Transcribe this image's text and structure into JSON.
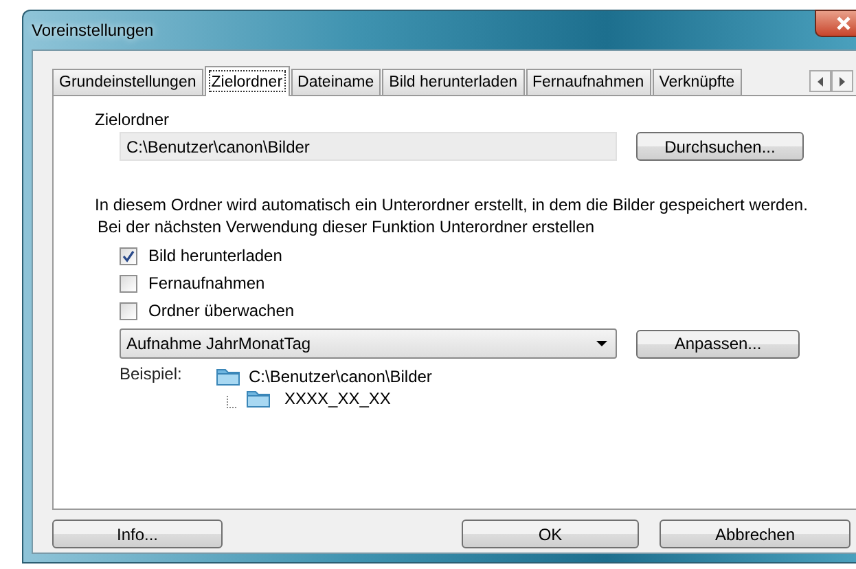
{
  "window": {
    "title": "Voreinstellungen"
  },
  "tabs": [
    {
      "label": "Grundeinstellungen",
      "selected": false
    },
    {
      "label": "Zielordner",
      "selected": true
    },
    {
      "label": "Dateiname",
      "selected": false
    },
    {
      "label": "Bild herunterladen",
      "selected": false
    },
    {
      "label": "Fernaufnahmen",
      "selected": false
    },
    {
      "label": "Verknüpfte",
      "selected": false
    }
  ],
  "destination": {
    "label": "Zielordner",
    "value": "C:\\Benutzer\\canon\\Bilder",
    "button": "Durchsuchen..."
  },
  "description": [
    "In diesem Ordner wird automatisch ein Unterordner erstellt, in dem die Bilder gespeichert werden.",
    "Bei der nächsten Verwendung dieser Funktion Unterordner erstellen"
  ],
  "options": [
    {
      "label": "Bild herunterladen",
      "checked": true
    },
    {
      "label": "Fernaufnahmen",
      "checked": false
    },
    {
      "label": "Ordner überwachen",
      "checked": false
    }
  ],
  "naming": {
    "value": "Aufnahme JahrMonatTag",
    "button": "Anpassen..."
  },
  "example": {
    "label": "Beispiel:",
    "root": "C:\\Benutzer\\canon\\Bilder",
    "subfolder": "XXXX_XX_XX"
  },
  "buttons": [
    {
      "label": "Info..."
    },
    {
      "label": "OK"
    },
    {
      "label": "Abbrechen"
    }
  ]
}
